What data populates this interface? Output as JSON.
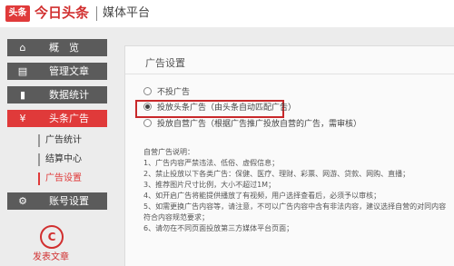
{
  "header": {
    "logo_text": "头条",
    "brand": "今日头条",
    "platform": "媒体平台"
  },
  "sidebar": {
    "items": [
      {
        "label": "概　览",
        "icon": "home-icon"
      },
      {
        "label": "管理文章",
        "icon": "document-icon"
      },
      {
        "label": "数据统计",
        "icon": "bar-chart-icon"
      },
      {
        "label": "头条广告",
        "icon": "yen-icon"
      },
      {
        "label": "账号设置",
        "icon": "gear-icon"
      }
    ],
    "sub_items": [
      "广告统计",
      "结算中心",
      "广告设置"
    ],
    "publish": {
      "icon_glyph": "C",
      "label": "发表文章"
    }
  },
  "panel": {
    "title": "广告设置",
    "options": [
      {
        "label": "不投广告",
        "selected": false
      },
      {
        "label": "投放头条广告（由头条自动匹配广告）",
        "selected": true
      },
      {
        "label": "投放自营广告（根据广告推广投放自营的广告，需审核）",
        "selected": false
      }
    ],
    "notes_title": "自营广告说明：",
    "notes": [
      "1、广告内容严禁违法、低俗、虚假信息；",
      "2、禁止投放以下各类广告：保健、医疗、理财、彩票、网游、贷款、网购、直播；",
      "3、推荐图片尺寸比例，大小不超过1M；",
      "4、如开启广告将能提供播放了有视频，用户选择查看后，必须予以审核；",
      "5、如需更换广告内容等，请注意，不可以广告内容中含有非法内容，建议选择自营的对同内容",
      "    符合内容规范要求；",
      "6、请勿在不同页面投放第三方媒体平台页面；"
    ]
  },
  "colors": {
    "accent": "#e03a3a",
    "nav_bg": "#5b5b5b",
    "highlight_border": "#c8282a"
  }
}
